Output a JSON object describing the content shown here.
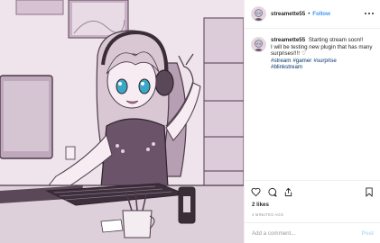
{
  "post": {
    "username": "streamette55",
    "follow_label": "Follow",
    "header_separator": "•",
    "caption": {
      "username": "streamette55",
      "text_line_1": "Starting stream soon!!",
      "text_line_2": "I will be testing new plugin that has many surprises!!!! ♡",
      "hashtags": [
        "#stream",
        "#gamer",
        "#surprise",
        "#blinkstream"
      ]
    },
    "likes_label": "2 likes",
    "timestamp": "4 minutes ago",
    "comment_placeholder": "Add a comment...",
    "post_label": "Post"
  },
  "icons": {
    "header": [
      "more-options-icon"
    ],
    "actions": [
      "heart-icon",
      "comment-icon",
      "share-icon",
      "bookmark-icon"
    ]
  },
  "colors": {
    "link_blue": "#3897f0",
    "hashtag_blue": "#003569",
    "muted_gray": "#999999",
    "post_button_disabled": "#b2dffc",
    "image_tint": "#ecdcea"
  }
}
